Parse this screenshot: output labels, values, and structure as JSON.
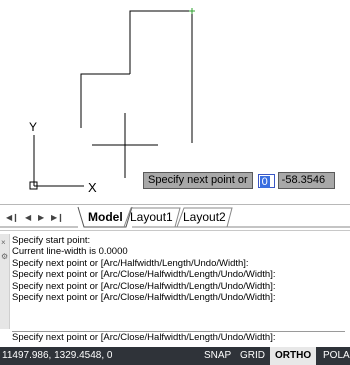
{
  "dynamic_input": {
    "prompt": "Specify next point or",
    "x_value": "0",
    "y_value": "-58.3546"
  },
  "viewport": {
    "ucs_y_label": "Y",
    "ucs_x_label": "X"
  },
  "layout_tabs": {
    "tabs": [
      "Model",
      "Layout1",
      "Layout2"
    ],
    "active": "Model"
  },
  "command_window": {
    "history": [
      "Specify start point:",
      "Current line-width is 0.0000",
      "Specify next point or [Arc/Halfwidth/Length/Undo/Width]:",
      "Specify next point or [Arc/Close/Halfwidth/Length/Undo/Width]:",
      "Specify next point or [Arc/Close/Halfwidth/Length/Undo/Width]:",
      "Specify next point or [Arc/Close/Halfwidth/Length/Undo/Width]:"
    ],
    "current_prompt": "Specify next point or [Arc/Close/Halfwidth/Length/Undo/Width]:"
  },
  "status_bar": {
    "coordinates": "11497.986, 1329.4548, 0",
    "buttons": [
      "SNAP",
      "GRID",
      "ORTHO",
      "POLA"
    ],
    "active_button": "ORTHO"
  },
  "colors": {
    "canvas": "#ffffff",
    "status_bar": "#2f3339",
    "selection": "#3a6fe0",
    "endpoint_marker": "#2ea02e"
  }
}
